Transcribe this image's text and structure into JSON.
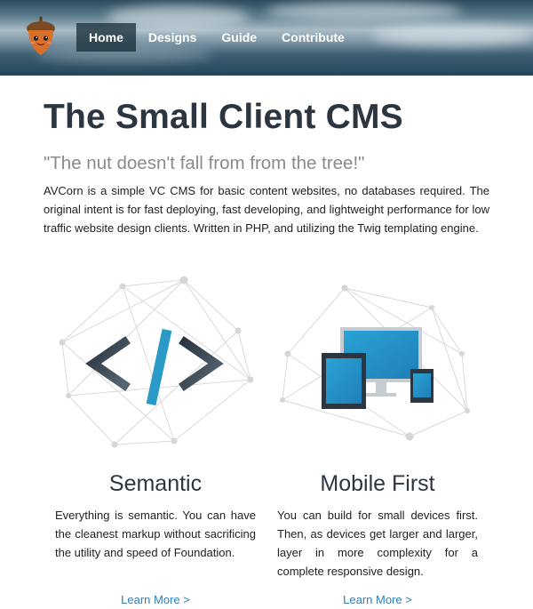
{
  "nav": {
    "items": [
      {
        "label": "Home",
        "active": true
      },
      {
        "label": "Designs",
        "active": false
      },
      {
        "label": "Guide",
        "active": false
      },
      {
        "label": "Contribute",
        "active": false
      }
    ]
  },
  "hero": {
    "title": "The Small Client CMS",
    "tagline": "\"The nut doesn't fall from from the tree!\"",
    "intro": "AVCorn is a simple VC CMS for basic content websites, no databases required. The original intent is for fast deploying, fast developing, and lightweight performance for low traffic website design clients. Written in PHP, and utilizing the Twig templating engine."
  },
  "features": [
    {
      "icon": "code-brackets-icon",
      "title": "Semantic",
      "text": "Everything is semantic. You can have the cleanest markup without sacrificing the utility and speed of Foundation.",
      "link": "Learn More >"
    },
    {
      "icon": "devices-icon",
      "title": "Mobile First",
      "text": "You can build for small devices first. Then, as devices get larger and larger, layer in more complexity for a complete responsive design.",
      "link": "Learn More >"
    }
  ],
  "colors": {
    "accent": "#2f7fb3",
    "heading": "#2c3640",
    "nav_active_bg": "#1e3440"
  }
}
